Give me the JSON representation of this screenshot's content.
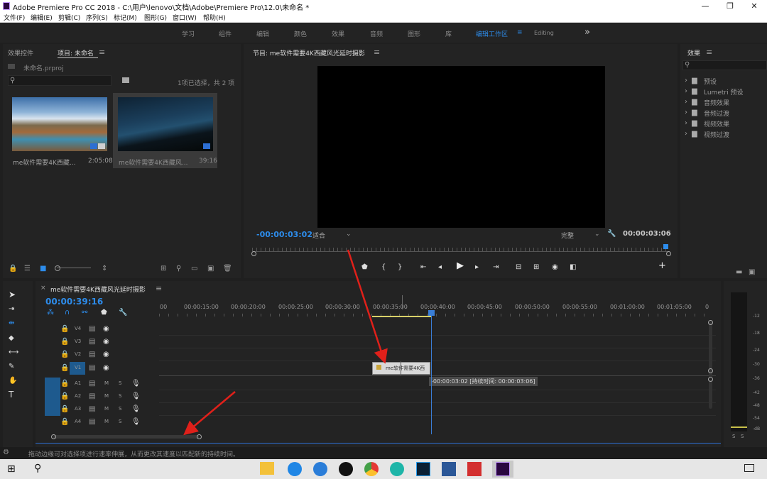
{
  "window": {
    "title": "Adobe Premiere Pro CC 2018 - C:\\用户\\lenovo\\文档\\Adobe\\Premiere Pro\\12.0\\未命名 *",
    "minimize": "—",
    "maximize": "❐",
    "close": "✕"
  },
  "menu": [
    "文件(F)",
    "编辑(E)",
    "剪辑(C)",
    "序列(S)",
    "标记(M)",
    "图形(G)",
    "窗口(W)",
    "帮助(H)"
  ],
  "workspaces": {
    "items": [
      "学习",
      "组件",
      "编辑",
      "颜色",
      "效果",
      "音频",
      "图形",
      "库",
      "编辑工作区"
    ],
    "active": "编辑工作区",
    "menu_icon": "≡",
    "editing": "Editing",
    "more": "»"
  },
  "project_panel": {
    "tab_effects_controls": "效果控件",
    "tab_project": "项目: 未命名",
    "tab_menu": "≡",
    "file": "未命名.prproj",
    "selection_info": "1项已选择，共 2 项",
    "items": [
      {
        "name": "me软件需要4K西藏...",
        "duration": "2:05:08"
      },
      {
        "name": "me软件需要4K西藏风...",
        "duration": "39:16"
      }
    ]
  },
  "program_monitor": {
    "tab": "节目: me软件需要4K西藏风光延时摄影",
    "tab_menu": "≡",
    "current_time": "-00:00:03:02",
    "fit": "适合",
    "quality": "完整",
    "duration": "00:00:03:06"
  },
  "effects_panel": {
    "tab": "效果",
    "tab_menu": "≡",
    "folders": [
      "预设",
      "Lumetri 预设",
      "音频效果",
      "音频过渡",
      "视频效果",
      "视频过渡"
    ]
  },
  "timeline": {
    "tab": "me软件需要4K西藏风光延时摄影",
    "tab_close": "×",
    "tab_menu": "≡",
    "timecode": "00:00:39:16",
    "ruler": [
      "00",
      "00:00:15:00",
      "00:00:20:00",
      "00:00:25:00",
      "00:00:30:00",
      "00:00:35:00",
      "00:00:40:00",
      "00:00:45:00",
      "00:00:50:00",
      "00:00:55:00",
      "00:01:00:00",
      "00:01:05:00",
      "0"
    ],
    "video_tracks": [
      "V4",
      "V3",
      "V2",
      "V1"
    ],
    "audio_tracks": [
      "A1",
      "A2",
      "A3",
      "A4"
    ],
    "clip_label": "me软件需要4K西",
    "tooltip": "-00:00:03:02 [持续时间: 00:00:03:06]",
    "meter_scale": [
      "-12",
      "-18",
      "-24",
      "-30",
      "-36",
      "-42",
      "-48",
      "-54",
      "-dB"
    ],
    "meter_solo": [
      "S",
      "S"
    ]
  },
  "status": {
    "message": "拖动边缘可对选择项进行速率伸展，从而更改其速度以匹配新的持续时间。"
  },
  "colors": {
    "accent": "#2d8ceb",
    "panel": "#232323",
    "bg": "#1a1a1a",
    "arrow": "#e0201a"
  }
}
